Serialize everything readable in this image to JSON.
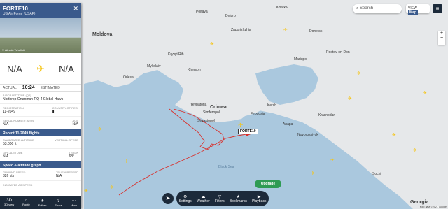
{
  "flight": {
    "callsign": "FORTE10",
    "operator": "US Air Force (USAF)",
    "photo_credit": "© Alfredo Tshallotti",
    "origin": "N/A",
    "destination": "N/A",
    "actual_label": "ACTUAL",
    "actual_time": "10:24",
    "estimated_label": "ESTIMATED",
    "aircraft_type_label": "AIRCRAFT TYPE (Q4)",
    "aircraft_type": "Northrop Grumman RQ-4 Global Hawk",
    "registration_label": "REGISTRATION",
    "registration": "11-2049",
    "country_label": "COUNTRY OF REG.",
    "serial_label": "SERIAL NUMBER (MSN)",
    "serial": "N/A",
    "age_label": "AGE",
    "age": "N/A",
    "recent_flights": "Recent 11-2049 flights",
    "cal_alt_label": "CALIBRATED ALTITUDE",
    "cal_alt": "53,000 ft",
    "vert_speed_label": "VERTICAL SPEED",
    "gps_alt_label": "GPS ALTITUDE",
    "gps_alt": "N/A",
    "track_label": "TRACK",
    "track": "68°",
    "speed_graph": "Speed & altitude graph",
    "ground_speed_label": "GROUND SPEED",
    "ground_speed": "326 kts",
    "true_airspeed_label": "TRUE AIRSPEED",
    "true_airspeed": "N/A",
    "indicated_label": "INDICATED AIRSPEED"
  },
  "panel_footer": [
    {
      "icon": "3D",
      "label": "3D view"
    },
    {
      "icon": "⌂",
      "label": "Route"
    },
    {
      "icon": "✈",
      "label": "Follow"
    },
    {
      "icon": "⇪",
      "label": "Share"
    },
    {
      "icon": "⋯",
      "label": "More"
    }
  ],
  "header": {
    "search": "Search",
    "view_label": "VIEW",
    "view_value": "Map"
  },
  "toolbar": [
    {
      "icon": "⚙",
      "label": "Settings"
    },
    {
      "icon": "☁",
      "label": "Weather"
    },
    {
      "icon": "▽",
      "label": "Filters"
    },
    {
      "icon": "★",
      "label": "Bookmarks"
    },
    {
      "icon": "▶",
      "label": "Playback"
    }
  ],
  "upgrade": "Upgrade",
  "map_tag": "FORTE10",
  "attribution": "Map data ©2021 Google",
  "map_labels": {
    "moldova": "Moldova",
    "crimea": "Crimea",
    "sevastopol": "Sevastopol",
    "krasnodar": "Krasnodar",
    "rostov": "Rostov-on-Don",
    "georgia": "Georgia",
    "black_sea": "Black Sea",
    "zaporizhzhia": "Zaporizhzhia",
    "kryvyi": "Kryvyi Rih",
    "kherson": "Kherson",
    "mykolaiv": "Mykolaiv",
    "odesa": "Odesa",
    "mariupol": "Mariupol",
    "dnipro": "Dnipro",
    "poltava": "Poltava",
    "kharkiv": "Kharkiv",
    "donetsk": "Donetsk",
    "simferopol": "Simferopol",
    "yevpatoria": "Yevpatoria",
    "kerch": "Kerch",
    "feodosia": "Feodosia",
    "novorossiysk": "Novorossiysk",
    "sochi": "Sochi",
    "anapa": "Anapa"
  }
}
